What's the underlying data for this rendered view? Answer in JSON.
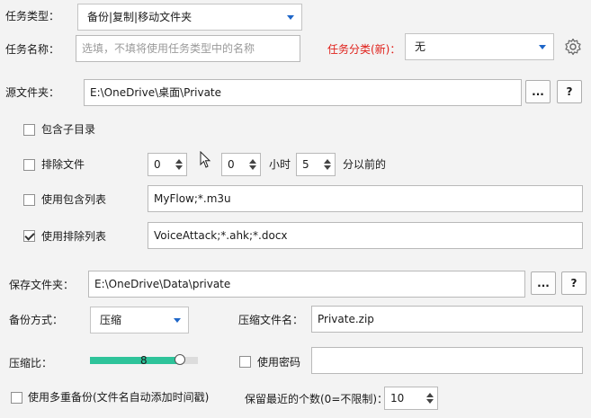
{
  "task_type": {
    "label": "任务类型：",
    "value": "备份|复制|移动文件夹"
  },
  "task_name": {
    "label": "任务名称：",
    "placeholder": "选填，不填将使用任务类型中的名称"
  },
  "task_category": {
    "label": "任务分类(新)：",
    "value": "无"
  },
  "source": {
    "label": "源文件夹：",
    "path": "E:\\OneDrive\\桌面\\Private",
    "browse_label": "...",
    "help_label": "?"
  },
  "include_subdirs": {
    "label": "包含子目录",
    "checked": false
  },
  "exclude_files": {
    "label": "排除文件",
    "checked": false,
    "spin1": "0",
    "spin2": "0",
    "hours_label": "小时",
    "spin3": "5",
    "minutes_label": "分以前的"
  },
  "include_list": {
    "label": "使用包含列表",
    "checked": false,
    "value": "MyFlow;*.m3u"
  },
  "exclude_list": {
    "label": "使用排除列表",
    "checked": true,
    "value": "VoiceAttack;*.ahk;*.docx"
  },
  "save_folder": {
    "label": "保存文件夹：",
    "path": "E:\\OneDrive\\Data\\private",
    "browse_label": "...",
    "help_label": "?"
  },
  "backup_mode": {
    "label": "备份方式：",
    "value": "压缩"
  },
  "zip_name": {
    "label": "压缩文件名：",
    "value": "Private.zip"
  },
  "compression": {
    "label": "压缩比：",
    "value": "8",
    "fraction": 0.8
  },
  "use_password": {
    "label": "使用密码",
    "checked": false,
    "value": ""
  },
  "multi_backup": {
    "label": "使用多重备份(文件名自动添加时间戳)",
    "checked": false
  },
  "keep_recent": {
    "label": "保留最近的个数(0=不限制)：",
    "value": "10"
  },
  "colors": {
    "accent": "#1e66c8",
    "slider": "#2ec39a",
    "warning": "#e0201a"
  }
}
